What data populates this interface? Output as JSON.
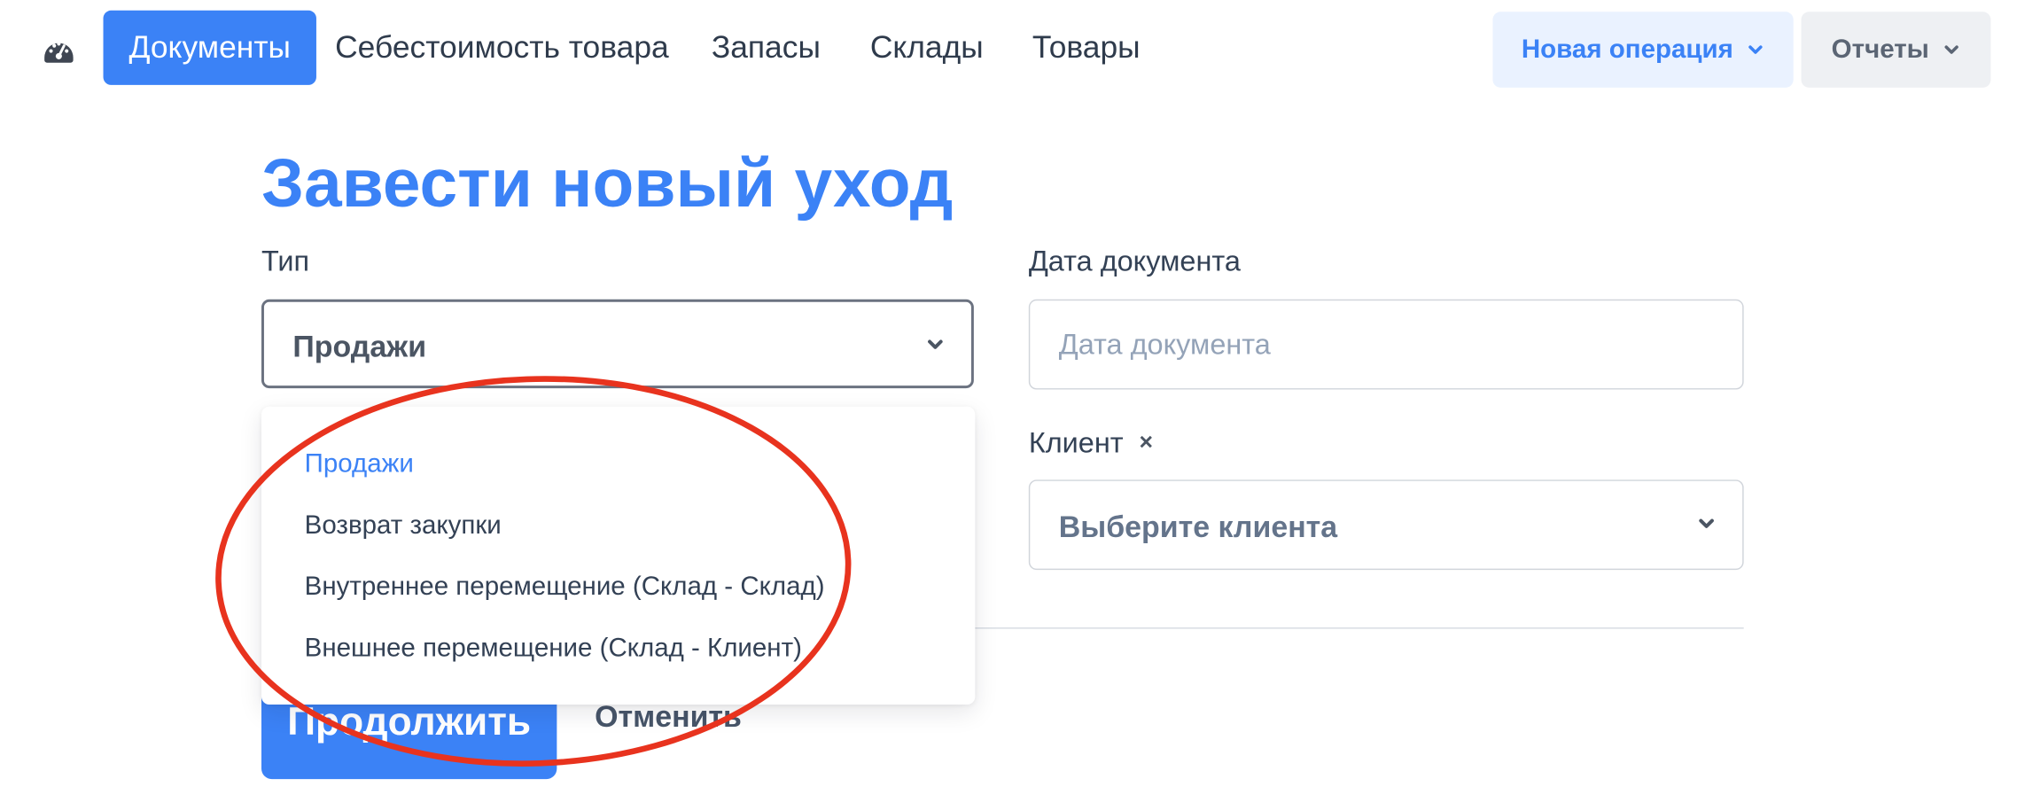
{
  "topnav": {
    "items": [
      {
        "label": "Документы",
        "active": true
      },
      {
        "label": "Себестоимость товара"
      },
      {
        "label": "Запасы"
      },
      {
        "label": "Склады"
      },
      {
        "label": "Товары"
      }
    ],
    "new_operation_label": "Новая операция",
    "reports_label": "Отчеты"
  },
  "page": {
    "title": "Завести новый уход"
  },
  "form": {
    "type_label": "Тип",
    "type_value": "Продажи",
    "type_options": [
      {
        "label": "Продажи",
        "selected": true
      },
      {
        "label": "Возврат закупки"
      },
      {
        "label": "Внутреннее перемещение (Склад - Склад)"
      },
      {
        "label": "Внешнее перемещение (Склад - Клиент)"
      }
    ],
    "date_label": "Дата документа",
    "date_placeholder": "Дата документа",
    "client_label": "Клиент",
    "client_placeholder": "Выберите клиента"
  },
  "actions": {
    "continue_label": "Продолжить",
    "cancel_label": "Отменить"
  },
  "colors": {
    "accent": "#3B82F6",
    "annotation": "#E8331E"
  },
  "icons": {
    "dashboard": "dashboard-speedometer-icon",
    "dropdown": "chevron-down-icon",
    "clear": "close-icon"
  }
}
